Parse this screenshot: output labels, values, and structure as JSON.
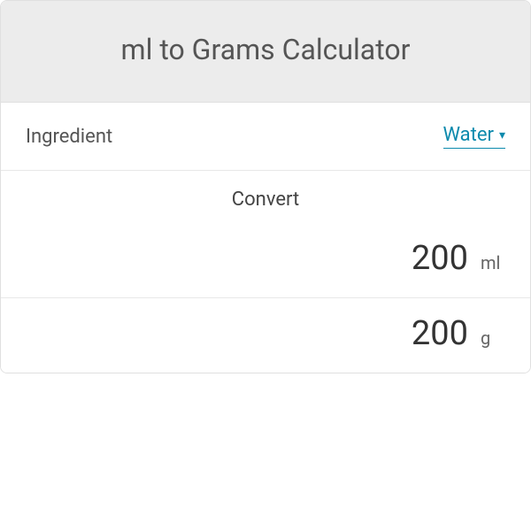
{
  "title": "ml to Grams Calculator",
  "ingredient": {
    "label": "Ingredient",
    "selected": "Water"
  },
  "convert": {
    "label": "Convert"
  },
  "volume": {
    "value": "200",
    "unit": "ml"
  },
  "mass": {
    "value": "200",
    "unit": "g"
  }
}
